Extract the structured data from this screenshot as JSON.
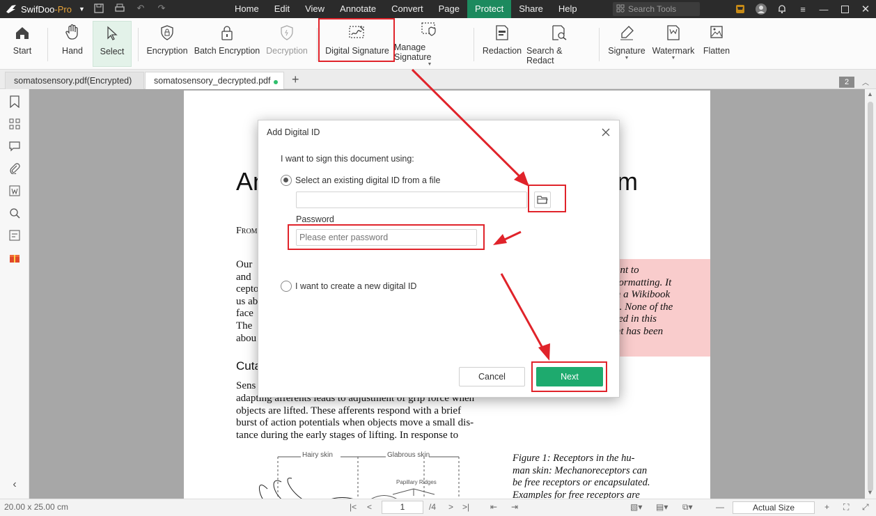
{
  "app": {
    "name": "SwifDoo",
    "name_suffix": "-Pro"
  },
  "menu": [
    "Home",
    "Edit",
    "View",
    "Annotate",
    "Convert",
    "Page",
    "Protect",
    "Share",
    "Help"
  ],
  "search": {
    "placeholder": "Search Tools"
  },
  "toolbar": {
    "start": "Start",
    "hand": "Hand",
    "select": "Select",
    "encryption": "Encryption",
    "batch_encryption": "Batch Encryption",
    "decryption": "Decryption",
    "digital_signature": "Digital Signature",
    "manage_signature": "Manage Signature",
    "redaction": "Redaction",
    "search_redact": "Search & Redact",
    "signature": "Signature",
    "watermark": "Watermark",
    "flatten": "Flatten"
  },
  "tabs": [
    "somatosensory.pdf(Encrypted)",
    "somatosensory_decrypted.pdf"
  ],
  "page_badge": "2",
  "document": {
    "title_left": "An",
    "title_right": "m",
    "from": "From",
    "left_col": [
      "Our",
      "and",
      "cepto",
      "us ab",
      "face",
      "The",
      "abou"
    ],
    "heading": "Cuta",
    "sens": "Sens",
    "body": [
      "adapting afferents leads to adjustment of grip force when",
      "objects are lifted. These afferents respond with a brief",
      "burst of action potentials when objects move a small dis-",
      "tance during the early stages of lifting. In response to"
    ],
    "note": [
      "ment to",
      "d formatting. It",
      "om a Wikibook",
      "ms. None of the",
      "nged in this",
      "tent has been"
    ],
    "caption": [
      "Figure 1:  Receptors in the hu-",
      "man skin: Mechanoreceptors can",
      "be free receptors or encapsulated.",
      "Examples for free receptors are"
    ],
    "fig": {
      "hairy": "Hairy skin",
      "glabrous": "Glabrous skin",
      "ridges": "Papillary Ridges"
    }
  },
  "dialog": {
    "title": "Add Digital ID",
    "prompt": "I want to sign this document using:",
    "option_existing": "Select an existing digital ID from a file",
    "password_label": "Password",
    "password_placeholder": "Please enter password",
    "option_new": "I want to create a new digital ID",
    "cancel": "Cancel",
    "next": "Next"
  },
  "status": {
    "size": "20.00 x 25.00 cm",
    "page": "1",
    "total": "/4",
    "zoom": "Actual Size"
  },
  "colors": {
    "accent": "#1eaa6e",
    "active_menu": "#1c8a5e",
    "annotation": "#e0232a"
  }
}
